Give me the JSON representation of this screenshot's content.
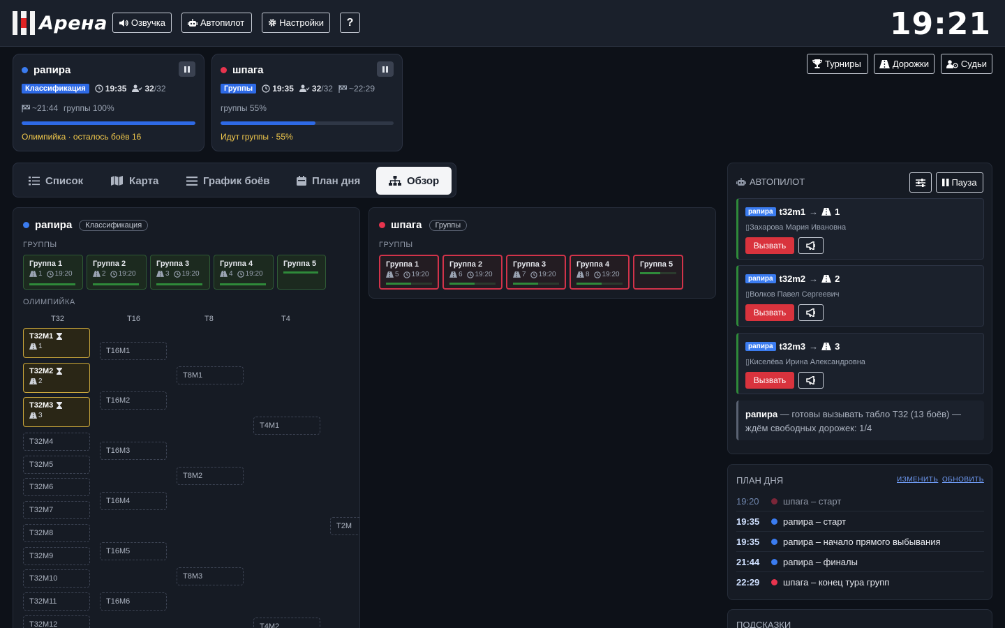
{
  "app": {
    "title": "Арена",
    "clock": "19:21",
    "buttons": {
      "voice": "Озвучка",
      "autopilot": "Автопилот",
      "settings": "Настройки",
      "help": "?"
    }
  },
  "weapons": [
    {
      "name": "рапира",
      "dot_color": "#3b7cf0",
      "phase": "Классификация",
      "time": "19:35",
      "fencers_done": "32",
      "fencers_total": "/32",
      "finish": "~21:44",
      "groups_progress": "группы 100%",
      "progress": 1.0,
      "status": "Олимпийка · осталось боёв 16"
    },
    {
      "name": "шпага",
      "dot_color": "#e8344e",
      "phase": "Группы",
      "time": "19:35",
      "fencers_done": "32",
      "fencers_total": "/32",
      "finish": "~22:29",
      "groups_progress": "группы 55%",
      "progress": 0.55,
      "status": "Идут группы · 55%"
    }
  ],
  "right_nav": {
    "tournaments": "Турниры",
    "pistes": "Дорожки",
    "referees": "Судьи"
  },
  "tabs": [
    {
      "label": "Список",
      "icon": "list-icon"
    },
    {
      "label": "Карта",
      "icon": "map-icon"
    },
    {
      "label": "График боёв",
      "icon": "schedule-icon"
    },
    {
      "label": "План дня",
      "icon": "calendar-icon"
    },
    {
      "label": "Обзор",
      "icon": "sitemap-icon",
      "active": true
    }
  ],
  "overview": {
    "rapier": {
      "name": "рапира",
      "phase": "Классификация",
      "groups_label": "ГРУППЫ",
      "groups": [
        {
          "name": "Группа 1",
          "piste": "1",
          "time": "19:20",
          "progress": 1.0
        },
        {
          "name": "Группа 2",
          "piste": "2",
          "time": "19:20",
          "progress": 1.0
        },
        {
          "name": "Группа 3",
          "piste": "3",
          "time": "19:20",
          "progress": 1.0
        },
        {
          "name": "Группа 4",
          "piste": "4",
          "time": "19:20",
          "progress": 1.0
        },
        {
          "name": "Группа 5",
          "piste": "",
          "time": "",
          "progress": 1.0
        }
      ],
      "bracket_label": "ОЛИМПИЙКА",
      "rounds": [
        "T32",
        "T16",
        "T8",
        "T4"
      ],
      "t32_active": [
        {
          "name": "T32M1",
          "piste": "1"
        },
        {
          "name": "T32M2",
          "piste": "2"
        },
        {
          "name": "T32M3",
          "piste": "3"
        }
      ],
      "t32_pending": [
        "T32M4",
        "T32M5",
        "T32M6",
        "T32M7",
        "T32M8",
        "T32M9",
        "T32M10",
        "T32M11",
        "T32M12"
      ],
      "t16": [
        "T16M1",
        "T16M2",
        "T16M3",
        "T16M4",
        "T16M5",
        "T16M6"
      ],
      "t8": [
        "T8M1",
        "T8M2",
        "T8M3"
      ],
      "t4": [
        "T4M1",
        "T4M2"
      ],
      "t2": "T2M"
    },
    "epee": {
      "name": "шпага",
      "phase": "Группы",
      "groups_label": "ГРУППЫ",
      "groups": [
        {
          "name": "Группа 1",
          "piste": "5",
          "time": "19:20",
          "progress": 0.55
        },
        {
          "name": "Группа 2",
          "piste": "6",
          "time": "19:20",
          "progress": 0.55
        },
        {
          "name": "Группа 3",
          "piste": "7",
          "time": "19:20",
          "progress": 0.55
        },
        {
          "name": "Группа 4",
          "piste": "8",
          "time": "19:20",
          "progress": 0.55
        },
        {
          "name": "Группа 5",
          "piste": "",
          "time": "",
          "progress": 0.4
        }
      ]
    }
  },
  "autopilot": {
    "title": "АВТОПИЛОТ",
    "pause_label": "Пауза",
    "calls": [
      {
        "weapon": "рапира",
        "bout": "t32m1",
        "piste": "1",
        "referee": "Захарова Мария Ивановна",
        "call_label": "Вызвать"
      },
      {
        "weapon": "рапира",
        "bout": "t32m2",
        "piste": "2",
        "referee": "Волков Павел Сергеевич",
        "call_label": "Вызвать"
      },
      {
        "weapon": "рапира",
        "bout": "t32m3",
        "piste": "3",
        "referee": "Киселёва Ирина Александровна",
        "call_label": "Вызвать"
      }
    ],
    "note_weapon": "рапира",
    "note_text": " — готовы вызывать табло T32 (13 боёв) — ждём свободных дорожек: 1/4"
  },
  "day_plan": {
    "title": "ПЛАН ДНЯ",
    "edit": "ИЗМЕНИТЬ",
    "refresh": "ОБНОВИТЬ",
    "items": [
      {
        "time": "19:20",
        "text": "шпага – старт",
        "color": "#7a2638",
        "past": true
      },
      {
        "time": "19:35",
        "text": "рапира – старт",
        "color": "#3b7cf0",
        "past": false
      },
      {
        "time": "19:35",
        "text": "рапира – начало прямого выбывания",
        "color": "#3b7cf0",
        "past": false
      },
      {
        "time": "21:44",
        "text": "рапира – финалы",
        "color": "#3b7cf0",
        "past": false
      },
      {
        "time": "22:29",
        "text": "шпага – конец тура групп",
        "color": "#e8344e",
        "past": false
      }
    ]
  },
  "hints": {
    "title": "ПОДСКАЗКИ"
  }
}
